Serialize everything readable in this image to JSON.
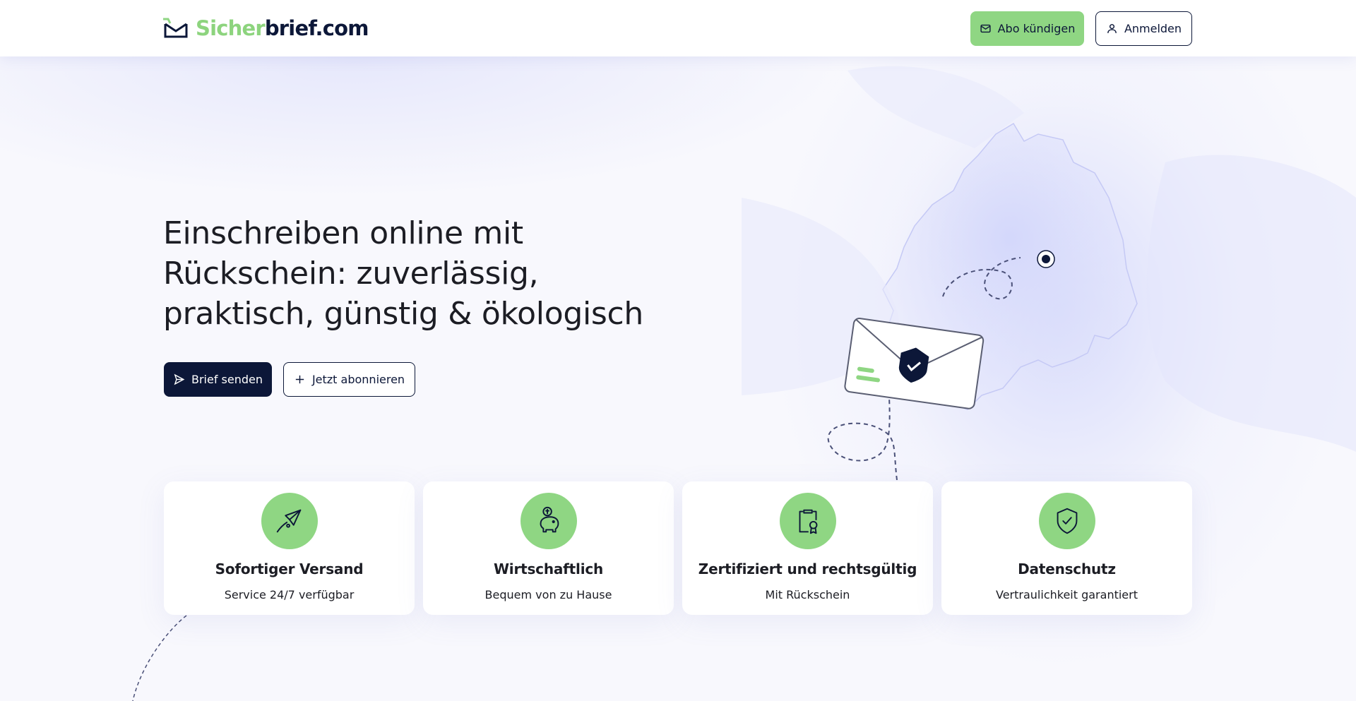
{
  "header": {
    "logo_part1": "Sicher",
    "logo_part2": "brief.com",
    "cancel_label": "Abo kündigen",
    "login_label": "Anmelden"
  },
  "hero": {
    "title": "Einschreiben online mit Rückschein: zuverlässig, praktisch, günstig & ökologisch",
    "send_label": "Brief senden",
    "subscribe_label": "Jetzt abonnieren"
  },
  "features": [
    {
      "title": "Sofortiger Versand",
      "subtitle": "Service 24/7 verfügbar",
      "icon": "paper-plane-icon"
    },
    {
      "title": "Wirtschaftlich",
      "subtitle": "Bequem von zu Hause",
      "icon": "piggy-bank-icon"
    },
    {
      "title": "Zertifiziert und rechtsgültig",
      "subtitle": "Mit Rückschein",
      "icon": "certificate-icon"
    },
    {
      "title": "Datenschutz",
      "subtitle": "Vertraulichkeit garantiert",
      "icon": "shield-check-icon"
    }
  ],
  "colors": {
    "brand_green": "#8fd683",
    "brand_navy": "#0c1738",
    "background": "#f8f8fd"
  }
}
